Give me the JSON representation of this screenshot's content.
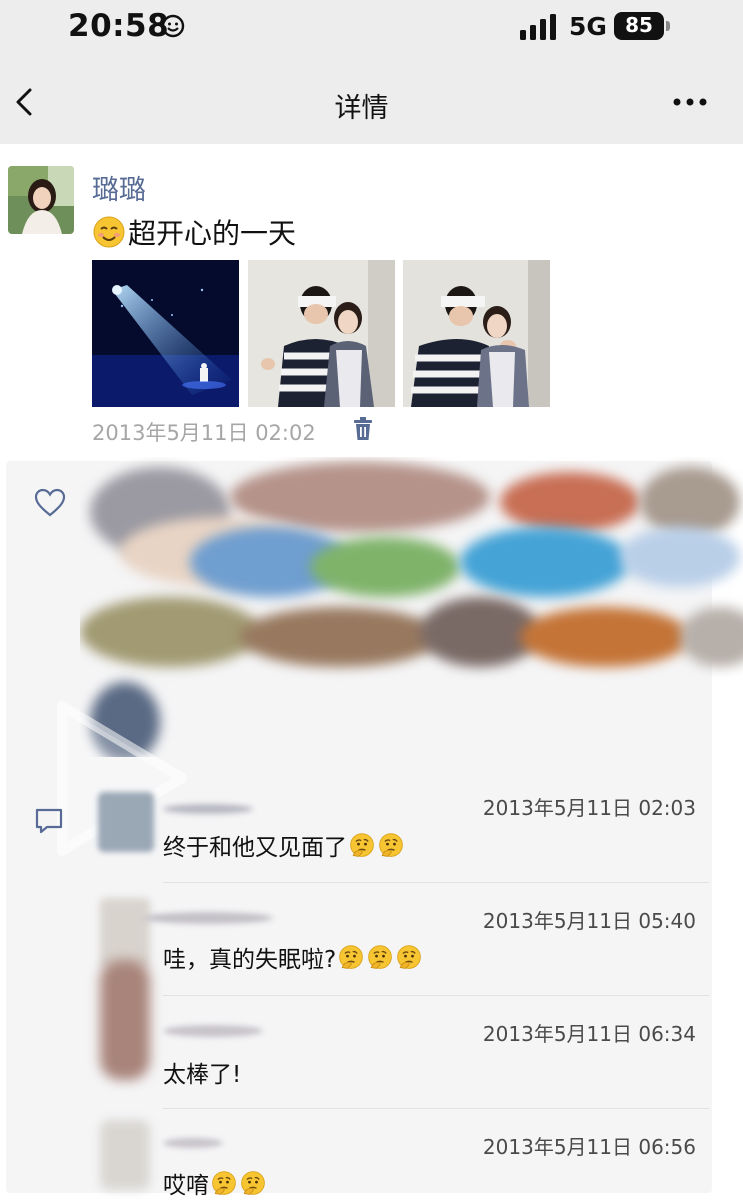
{
  "status_bar": {
    "time": "20:58",
    "network": "5G",
    "battery": "85"
  },
  "nav": {
    "title": "详情",
    "back_icon": "chevron-left-icon",
    "more_icon": "more-dots-icon"
  },
  "post": {
    "author": "璐璐",
    "emoji": "smiling-face-icon",
    "text": "超开心的一天",
    "images": [
      "stage-concert-photo",
      "couple-photo-1",
      "couple-photo-2"
    ],
    "timestamp": "2013年5月11日 02:02",
    "delete_icon": "trash-icon"
  },
  "likes": {
    "icon": "heart-icon"
  },
  "comments_section": {
    "icon": "comment-icon"
  },
  "comments": [
    {
      "time": "2013年5月11日 02:03",
      "text": "终于和他又见面了",
      "emoji_count": 2
    },
    {
      "time": "2013年5月11日 05:40",
      "text": "哇，真的失眠啦?",
      "emoji_count": 3
    },
    {
      "time": "2013年5月11日 06:34",
      "text": "太棒了!",
      "emoji_count": 0
    },
    {
      "time": "2013年5月11日 06:56",
      "text": "哎唷",
      "emoji_count": 2
    }
  ],
  "colors": {
    "author_link": "#576b95",
    "nav_bg": "#ededed",
    "panel_bg": "#f5f5f6",
    "meta_gray": "#a6a6a6"
  }
}
